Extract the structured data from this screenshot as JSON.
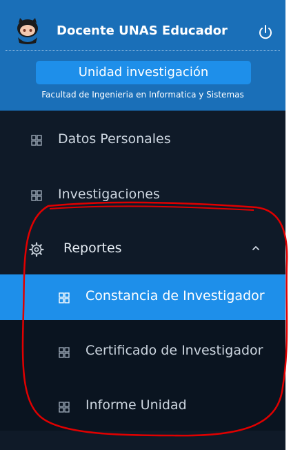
{
  "header": {
    "user_name": "Docente UNAS Educador",
    "unit_label": "Unidad investigación",
    "faculty": "Facultad de Ingenieria en Informatica y Sistemas",
    "avatar_icon": "octocat-avatar",
    "power_icon": "power-icon",
    "bg_color": "#1a6fb8"
  },
  "menu": {
    "items": [
      {
        "label": "Datos Personales",
        "icon": "grid-icon"
      },
      {
        "label": "Investigaciones",
        "icon": "grid-icon"
      },
      {
        "label": "Reportes",
        "icon": "gear-icon",
        "expanded": true
      }
    ],
    "reportes_submenu": [
      {
        "label": "Constancia de Investigador",
        "icon": "grid-icon",
        "active": true
      },
      {
        "label": "Certificado de Investigador",
        "icon": "grid-icon"
      },
      {
        "label": "Informe Unidad",
        "icon": "grid-icon"
      }
    ]
  },
  "colors": {
    "sidebar_bg": "#0f1a28",
    "active_bg": "#1e8fea",
    "annotation_stroke": "#e00000"
  }
}
